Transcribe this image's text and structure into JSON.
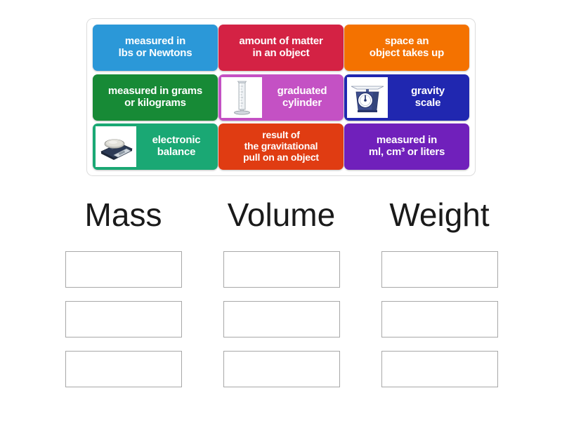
{
  "activity": {
    "type": "group-sort",
    "tile_bank": {
      "rows": [
        [
          {
            "text": "measured in\nlbs or Newtons",
            "line1": "measured in",
            "line2": "lbs or Newtons",
            "color": "#2b98d8",
            "media": null
          },
          {
            "text": "amount of matter\nin an object",
            "line1": "amount of matter",
            "line2": "in an object",
            "color": "#d42244",
            "media": null
          },
          {
            "text": "space an\nobject takes up",
            "line1": "space an",
            "line2": "object takes up",
            "color": "#f47200",
            "media": null
          }
        ],
        [
          {
            "text": "measured in grams\nor kilograms",
            "line1": "measured in grams",
            "line2": "or kilograms",
            "color": "#178a36",
            "media": null
          },
          {
            "text": "graduated\ncylinder",
            "line1": "graduated",
            "line2": "cylinder",
            "color": "#c451c4",
            "media": "graduated-cylinder-image"
          },
          {
            "text": "gravity\nscale",
            "line1": "gravity",
            "line2": "scale",
            "color": "#2027b0",
            "media": "kitchen-spring-scale-image"
          }
        ],
        [
          {
            "text": "electronic\nbalance",
            "line1": "electronic",
            "line2": "balance",
            "color": "#1aa874",
            "media": "electronic-balance-image"
          },
          {
            "text": "result of\nthe gravitational\npull on an object",
            "line1": "result of",
            "line2": "the gravitational",
            "line3": "pull on an object",
            "color": "#e03c12",
            "media": null
          },
          {
            "text": "measured in\nml, cm³ or liters",
            "line1": "measured in",
            "line2": "ml, cm³ or liters",
            "color": "#7020bb",
            "media": null
          }
        ]
      ]
    },
    "categories": [
      {
        "title": "Mass",
        "slots": [
          "",
          "",
          ""
        ]
      },
      {
        "title": "Volume",
        "slots": [
          "",
          "",
          ""
        ]
      },
      {
        "title": "Weight",
        "slots": [
          "",
          "",
          ""
        ]
      }
    ],
    "colors": {
      "card_border": "#dcdcdc",
      "dropzone_border": "#a8a8a8",
      "background": "#ffffff",
      "title_text": "#1a1a1a",
      "tile_text": "#ffffff"
    }
  }
}
